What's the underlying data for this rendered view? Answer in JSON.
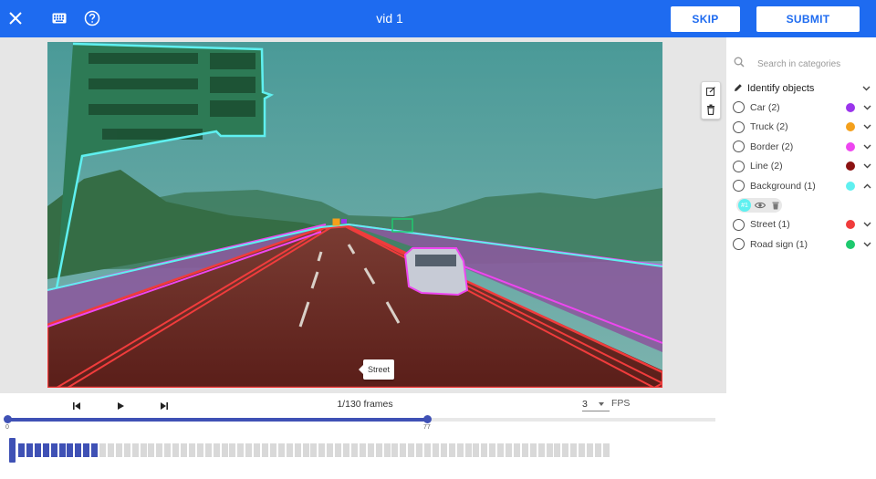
{
  "header": {
    "title": "vid 1",
    "skip_label": "SKIP",
    "submit_label": "SUBMIT",
    "icons": [
      "close-icon",
      "keyboard-icon",
      "help-icon"
    ],
    "accent_color": "#1e6bf0"
  },
  "canvas": {
    "tooltip": "Street",
    "tools": [
      "edit-icon",
      "delete-icon"
    ]
  },
  "sidebar": {
    "search_placeholder": "Search in categories",
    "section_label": "Identify objects",
    "categories": [
      {
        "label": "Car (2)",
        "color": "#9b35ec",
        "expanded": false
      },
      {
        "label": "Truck (2)",
        "color": "#f4a01b",
        "expanded": false
      },
      {
        "label": "Border (2)",
        "color": "#ee46f0",
        "expanded": false
      },
      {
        "label": "Line (2)",
        "color": "#8b1212",
        "expanded": false
      },
      {
        "label": "Background (1)",
        "color": "#5ff0f0",
        "expanded": true
      },
      {
        "label": "Street (1)",
        "color": "#f03c3c",
        "expanded": false
      },
      {
        "label": "Road sign (1)",
        "color": "#1ec96e",
        "expanded": false
      }
    ],
    "instance_badge": "#1"
  },
  "playback": {
    "frame_label": "1/130 frames",
    "fps_value": "3",
    "fps_label": "FPS",
    "range_start": "0",
    "range_end": "77",
    "range_fraction": 0.5925,
    "total_frames": 130,
    "annotated_cells": 10,
    "total_cells": 73,
    "active_color": "#3f51b5"
  }
}
